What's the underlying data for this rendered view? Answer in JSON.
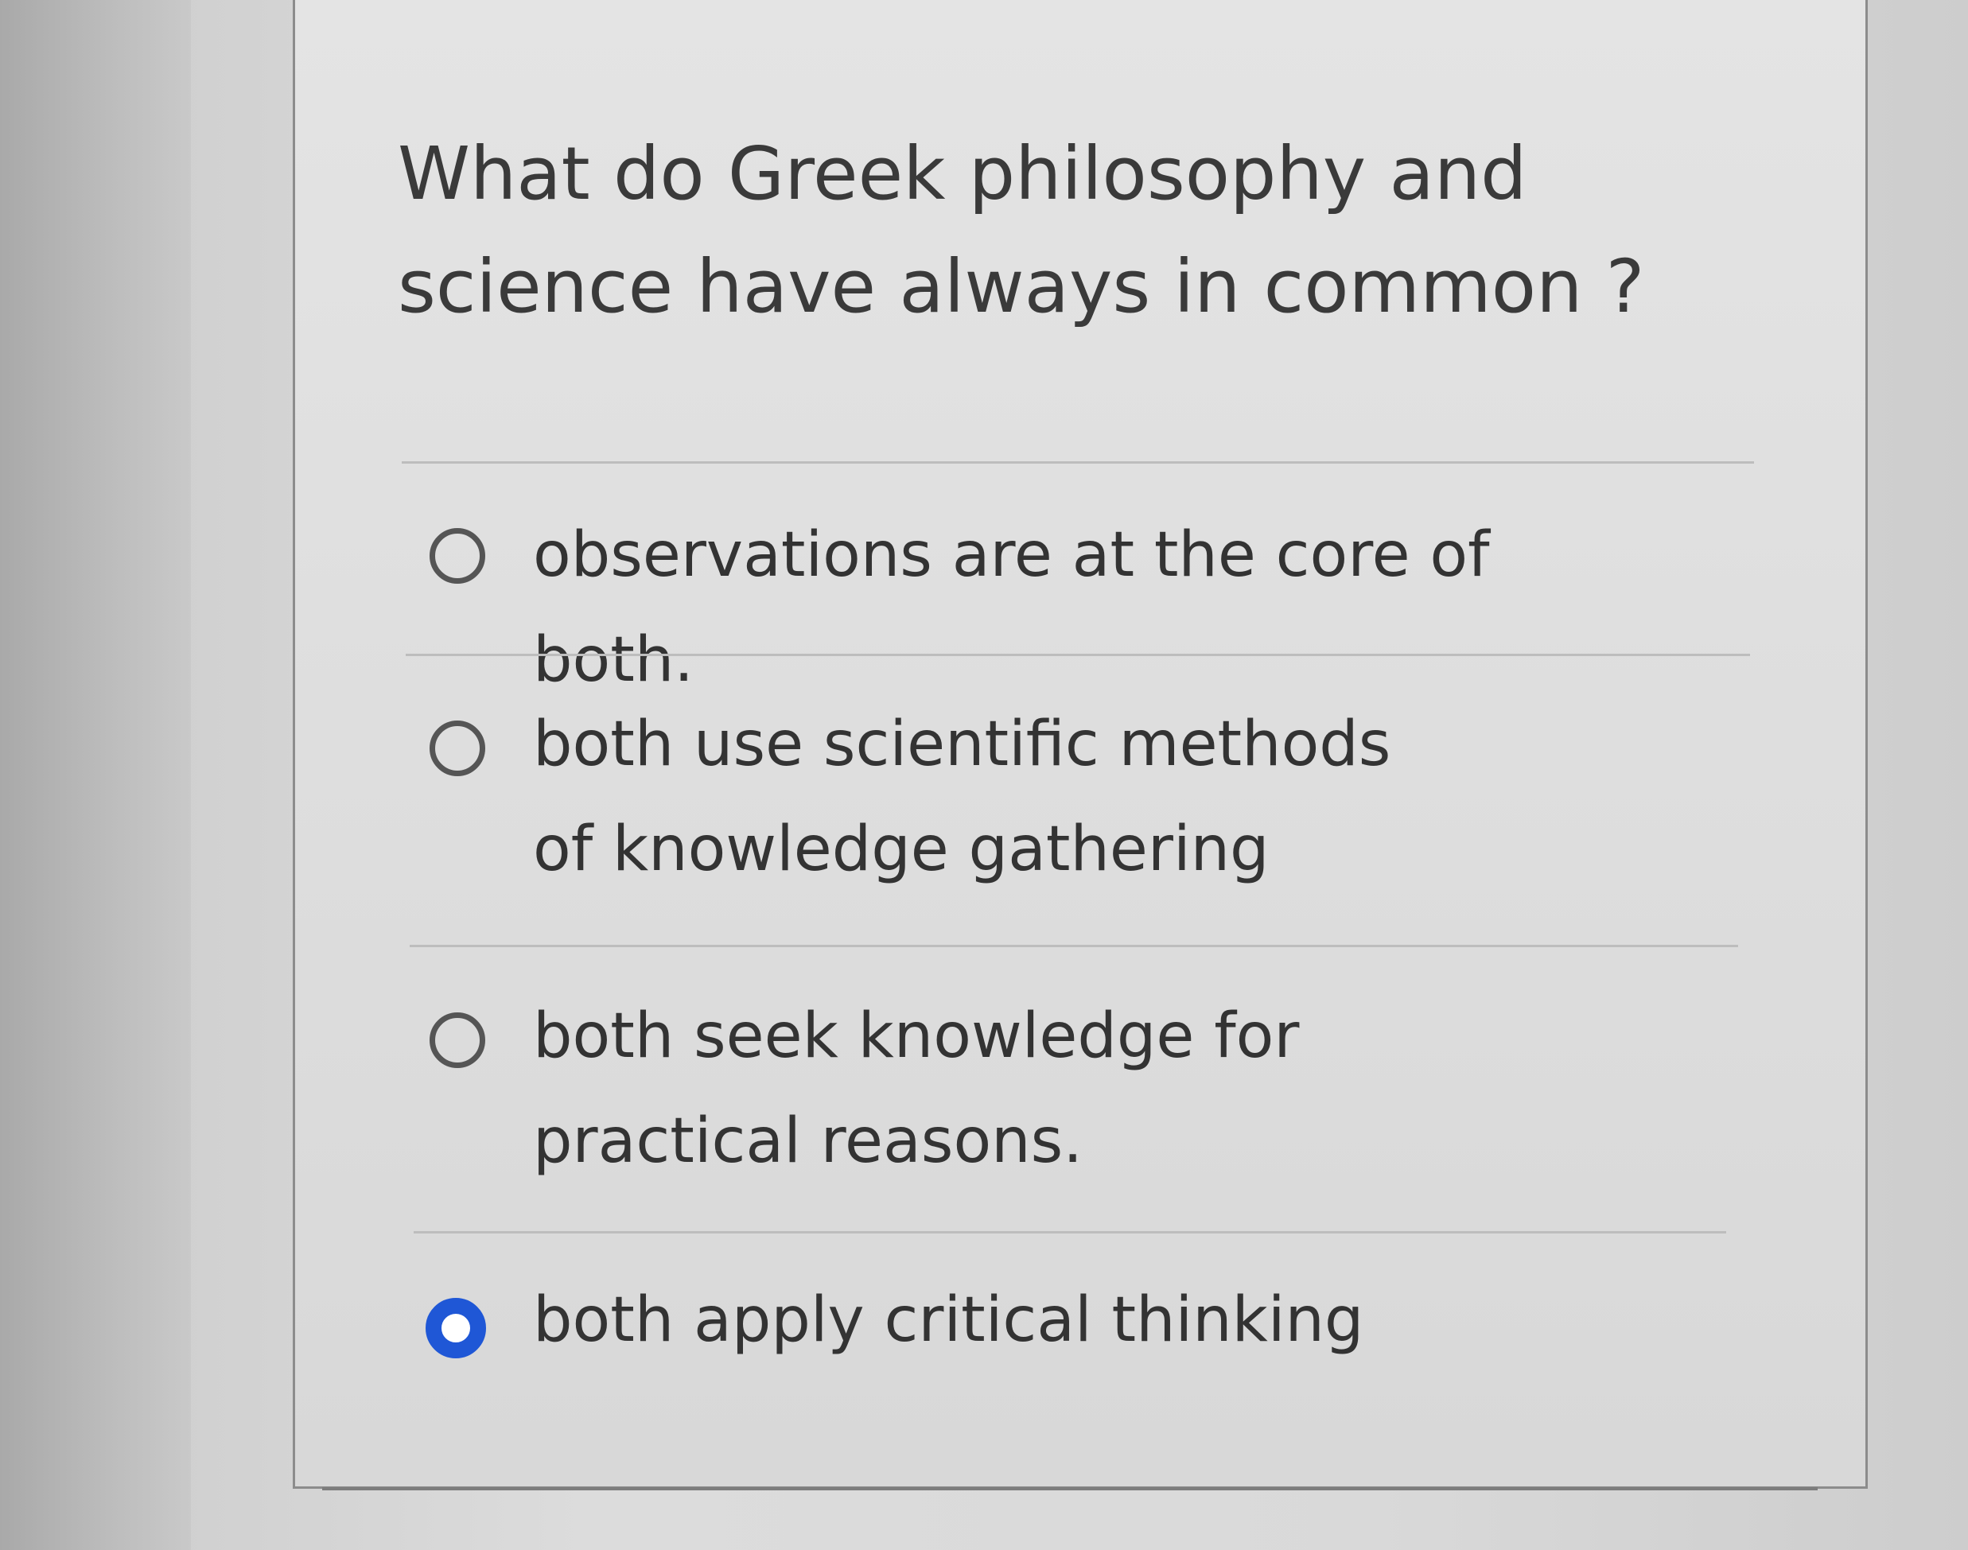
{
  "question": {
    "text": "What do Greek philosophy and science have always in common ?"
  },
  "options": [
    {
      "label": "observations are at the core of both.",
      "selected": false
    },
    {
      "label": "both use scientific methods of knowledge gathering",
      "selected": false
    },
    {
      "label": "both seek knowledge for practical reasons.",
      "selected": false
    },
    {
      "label": "both apply critical thinking",
      "selected": true
    }
  ],
  "colors": {
    "selected_radio": "#1f57d6",
    "radio_border": "#555555",
    "text": "#333333"
  }
}
